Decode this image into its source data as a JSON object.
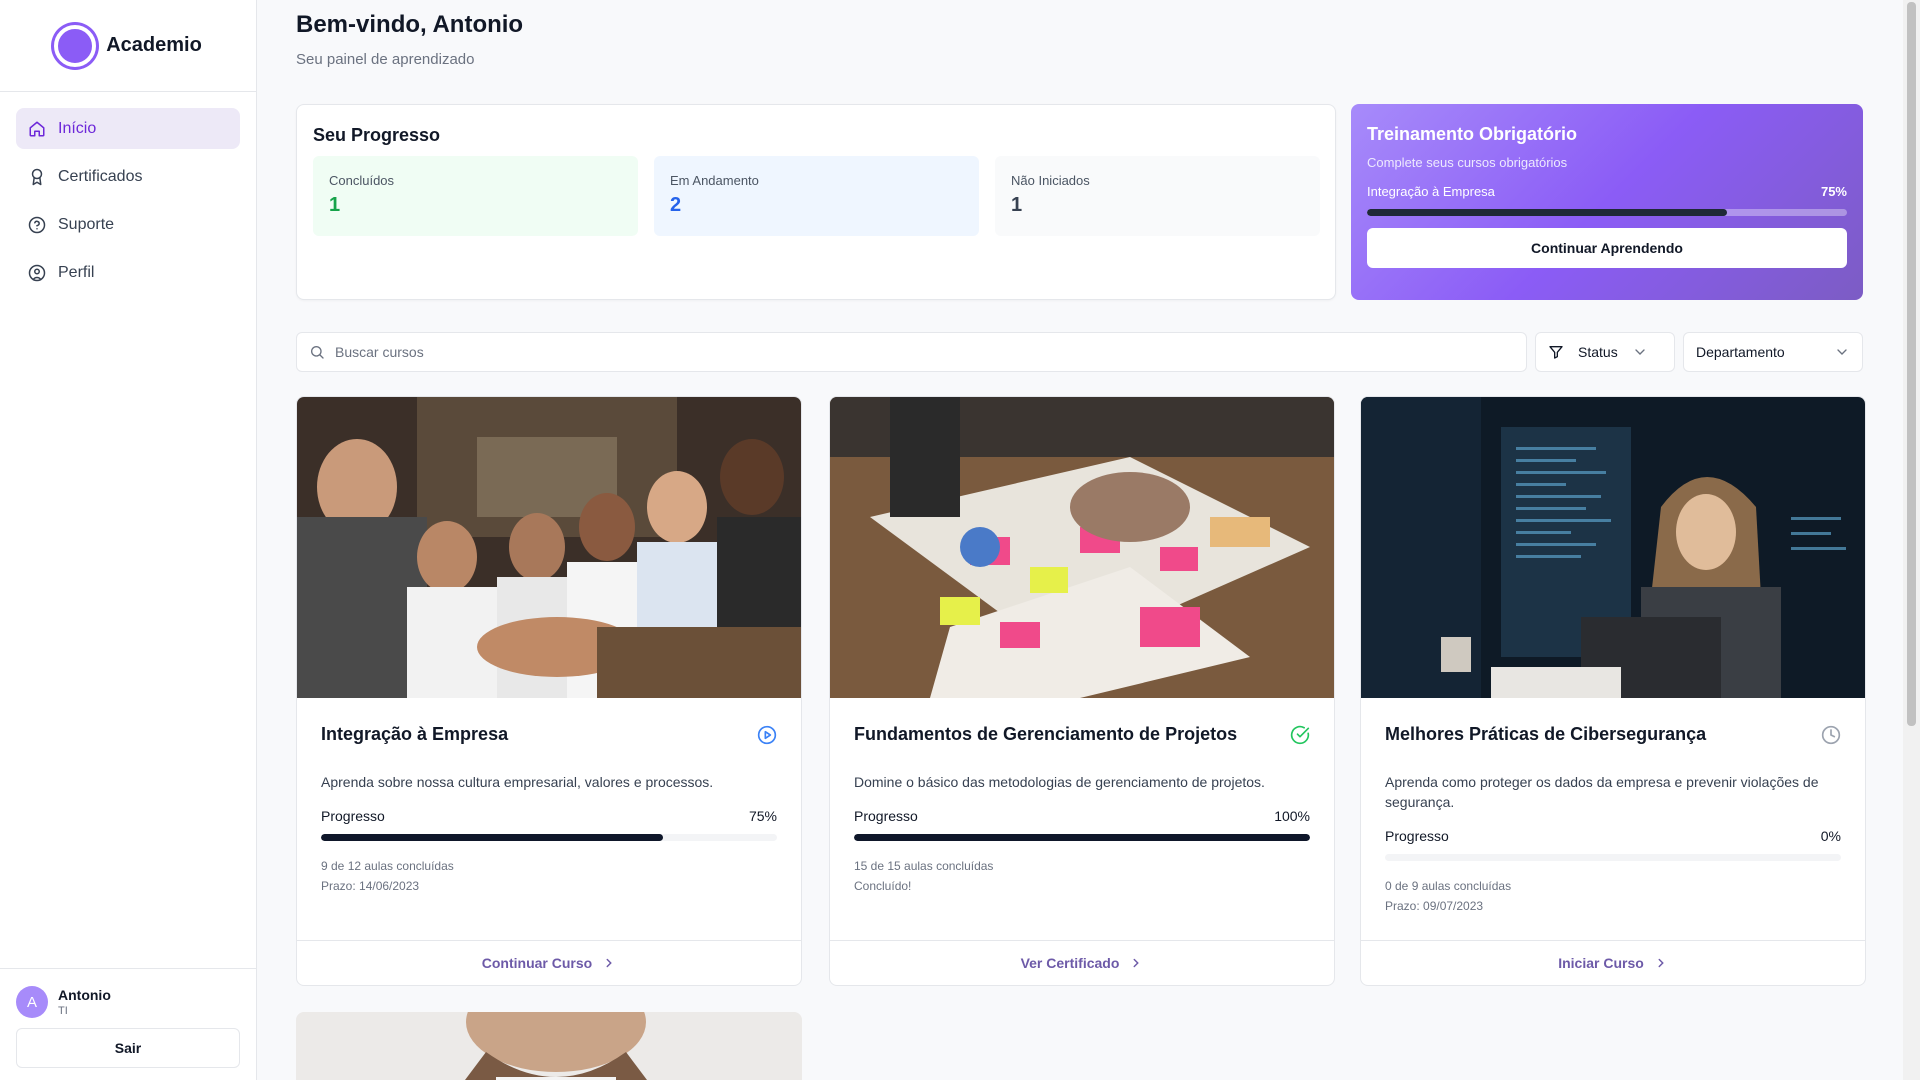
{
  "brand": {
    "name": "Academio"
  },
  "sidebar": {
    "items": [
      {
        "label": "Início",
        "icon": "home-icon",
        "active": true
      },
      {
        "label": "Certificados",
        "icon": "award-icon"
      },
      {
        "label": "Suporte",
        "icon": "help-circle-icon"
      },
      {
        "label": "Perfil",
        "icon": "user-circle-icon"
      }
    ]
  },
  "user": {
    "initial": "A",
    "name": "Antonio",
    "department": "TI",
    "logout_label": "Sair"
  },
  "header": {
    "greeting": "Bem-vindo, Antonio",
    "subtitle": "Seu painel de aprendizado"
  },
  "progress": {
    "title": "Seu Progresso",
    "stats": [
      {
        "label": "Concluídos",
        "value": "1",
        "color": "#16a34a"
      },
      {
        "label": "Em Andamento",
        "value": "2",
        "color": "#2563eb"
      },
      {
        "label": "Não Iniciados",
        "value": "1",
        "color": "#374151"
      }
    ]
  },
  "mandatory": {
    "title": "Treinamento Obrigatório",
    "description": "Complete seus cursos obrigatórios",
    "course": "Integração à Empresa",
    "percent_label": "75%",
    "progress": 0.75,
    "button_label": "Continuar Aprendendo"
  },
  "filters": {
    "search_placeholder": "Buscar cursos",
    "status_label": "Status",
    "department_label": "Departamento"
  },
  "courses": [
    {
      "title": "Integração à Empresa",
      "status_icon": "play-circle-icon",
      "status_color": "#3b82f6",
      "description": "Aprenda sobre nossa cultura empresarial, valores e processos.",
      "progress_label": "Progresso",
      "percent_label": "75%",
      "progress": 0.75,
      "lessons": "9 de 12 aulas concluídas",
      "deadline": "Prazo: 14/06/2023",
      "action": "Continuar Curso"
    },
    {
      "title": "Fundamentos de Gerenciamento de Projetos",
      "status_icon": "check-circle-icon",
      "status_color": "#22c55e",
      "description": "Domine o básico das metodologias de gerenciamento de projetos.",
      "progress_label": "Progresso",
      "percent_label": "100%",
      "progress": 1.0,
      "lessons": "15 de 15 aulas concluídas",
      "deadline": "Concluído!",
      "action": "Ver Certificado"
    },
    {
      "title": "Melhores Práticas de Cibersegurança",
      "status_icon": "clock-icon",
      "status_color": "#9ca3af",
      "description": "Aprenda como proteger os dados da empresa e prevenir violações de segurança.",
      "progress_label": "Progresso",
      "percent_label": "0%",
      "progress": 0.0,
      "lessons": "0 de 9 aulas concluídas",
      "deadline": "Prazo: 09/07/2023",
      "action": "Iniciar Curso"
    }
  ]
}
